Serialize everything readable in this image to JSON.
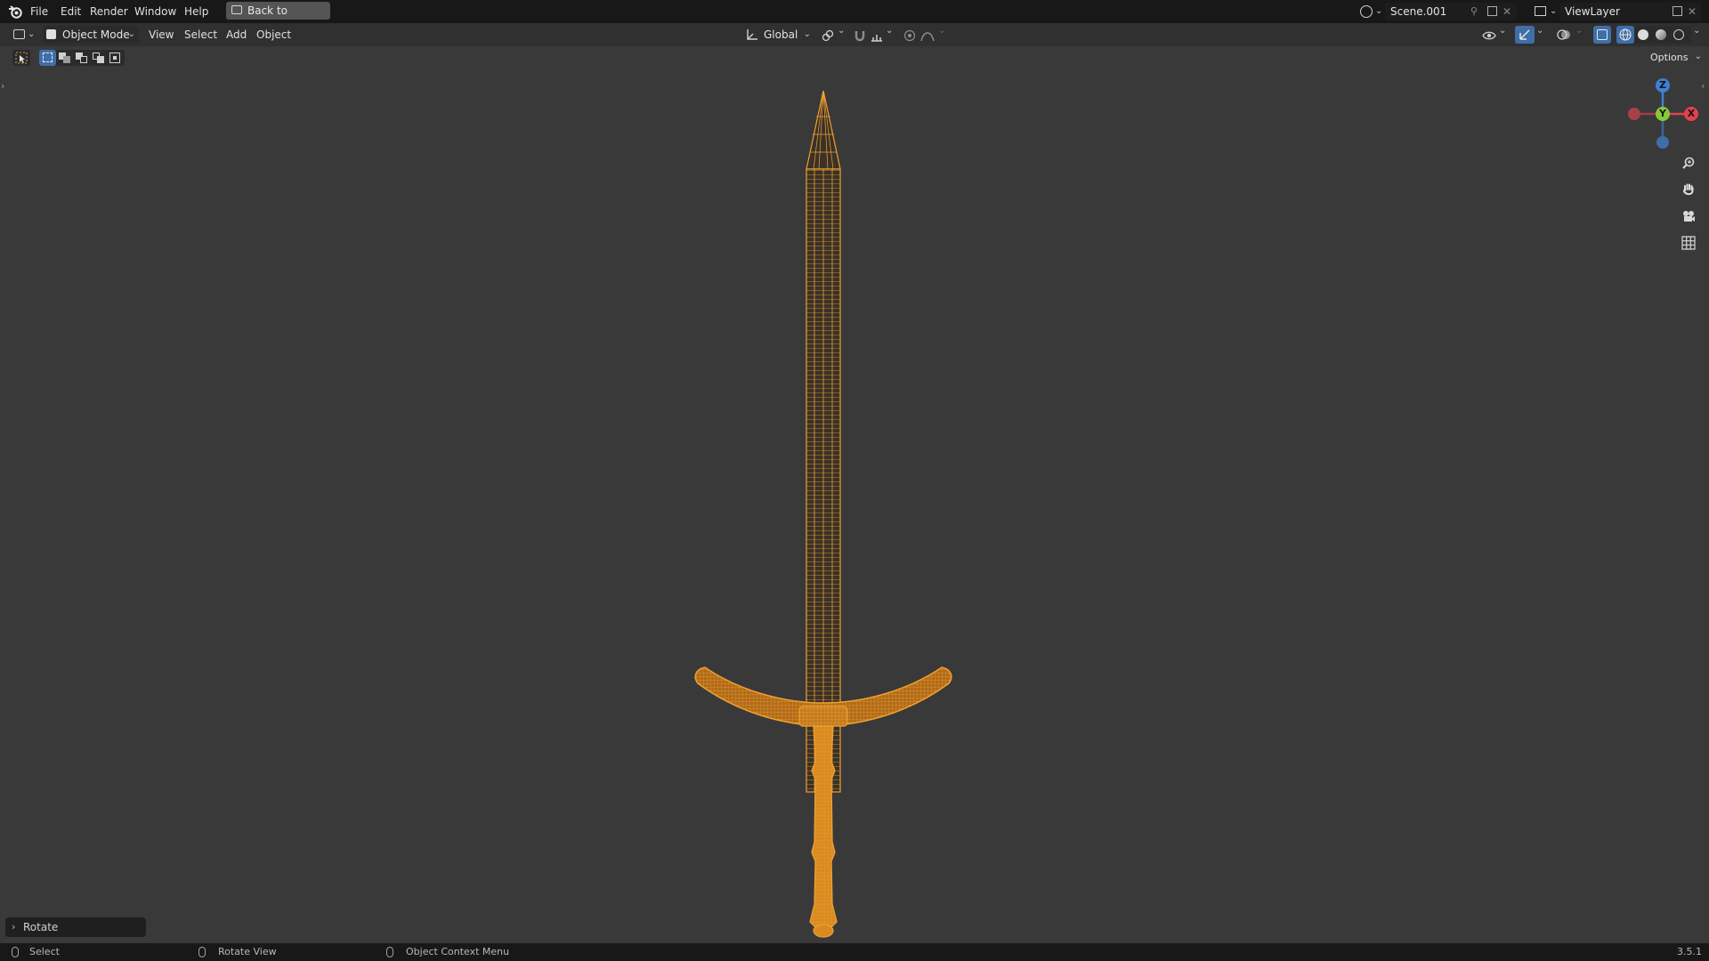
{
  "menubar": {
    "items": [
      "File",
      "Edit",
      "Render",
      "Window",
      "Help"
    ],
    "back_button": "Back to Previous",
    "scene_name": "Scene.001",
    "view_layer": "ViewLayer"
  },
  "header": {
    "mode": "Object Mode",
    "menus": [
      "View",
      "Select",
      "Add",
      "Object"
    ],
    "orientation": "Global",
    "options": "Options"
  },
  "redo_panel": {
    "label": "Rotate"
  },
  "status": {
    "select": "Select",
    "rotate_view": "Rotate View",
    "context_menu": "Object Context Menu",
    "version": "3.5.1"
  },
  "gizmo": {
    "z": "Z",
    "y": "Y",
    "x": "X"
  },
  "colors": {
    "selection_orange": "#f0a030",
    "axis_x": "#e0434f",
    "axis_y": "#86c93a",
    "axis_z": "#3d80d8"
  },
  "icons": {
    "blender_logo": "blender-icon",
    "zoom": "zoom-icon",
    "pan": "hand-icon",
    "camera": "camera-icon",
    "grid": "grid-icon"
  }
}
